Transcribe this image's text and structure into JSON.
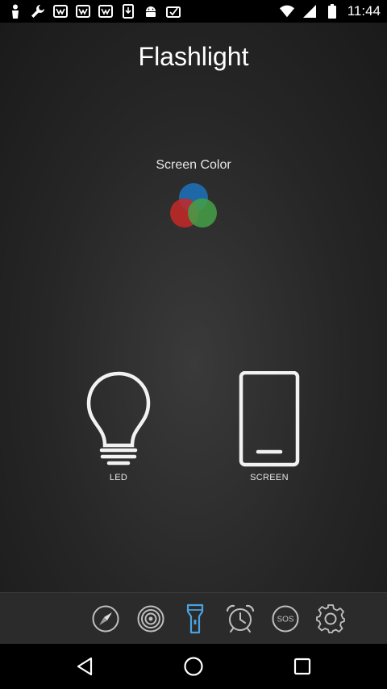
{
  "status_bar": {
    "time": "11:44",
    "left_icons": [
      "person-icon",
      "wrench-icon",
      "store-icon",
      "store-icon",
      "store-icon",
      "download-icon",
      "android-icon",
      "inbox-icon"
    ],
    "right_icons": [
      "wifi-icon",
      "signal-icon",
      "battery-icon"
    ]
  },
  "main": {
    "title": "Flashlight",
    "screen_color_label": "Screen Color",
    "modes": [
      {
        "label": "LED",
        "icon": "light-bulb-icon"
      },
      {
        "label": "SCREEN",
        "icon": "phone-screen-icon"
      }
    ]
  },
  "toolbar": {
    "items": [
      "compass-icon",
      "target-icon",
      "flashlight-icon",
      "alarm-clock-icon",
      "sos-icon",
      "settings-icon"
    ],
    "sos_text": "SOS",
    "active_color": "#4aa3df"
  },
  "colors": {
    "red": "#c62828",
    "green": "#43a047",
    "blue": "#1e6fb5"
  }
}
